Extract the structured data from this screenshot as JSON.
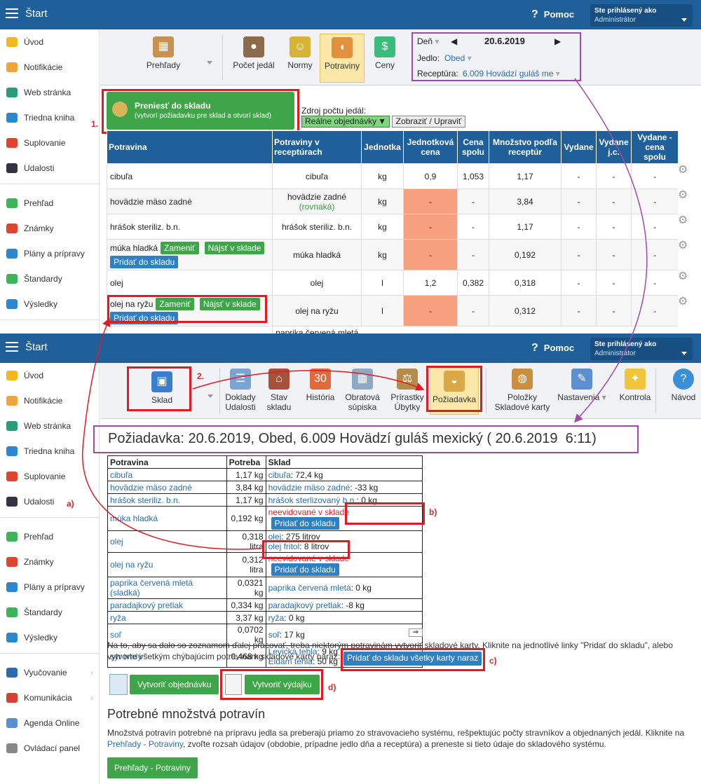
{
  "top": {
    "title": "Štart",
    "help": "Pomoc",
    "help_icon": "?",
    "user_line1": "Ste prihlásený ako",
    "user_line2": "Administrátor"
  },
  "sidebar1": [
    "Úvod",
    "Notifikácie",
    "Web stránka",
    "Triedna kniha",
    "Suplovanie",
    "Udalosti",
    "Prehľad",
    "Známky",
    "Plány a prípravy",
    "Štandardy",
    "Výsledky",
    "Vyučovanie"
  ],
  "sidebar2": [
    "Úvod",
    "Notifikácie",
    "Web stránka",
    "Triedna kniha",
    "Suplovanie",
    "Udalosti",
    "Prehľad",
    "Známky",
    "Plány a prípravy",
    "Štandardy",
    "Výsledky",
    "Vyučovanie",
    "Komunikácia",
    "Agenda Online",
    "Ovládací panel"
  ],
  "toolbar1": {
    "prehlady": "Prehľady",
    "pocet": "Počet jedál",
    "normy": "Normy",
    "potraviny": "Potraviny",
    "ceny": "Ceny"
  },
  "filter": {
    "den_label": "Deň",
    "date": "20.6.2019",
    "jedlo_label": "Jedlo:",
    "jedlo": "Obed",
    "receptura_label": "Receptúra:",
    "receptura": "6.009 Hovädzí guláš me"
  },
  "prenest": {
    "l1": "Preniesť do skladu",
    "l2": "(vytvorí požiadavku pre sklad a otvorí sklad)",
    "num": "1."
  },
  "zdroj": {
    "label": "Zdroj počtu jedál:",
    "select": "Reálne objednávky",
    "btn": "Zobraziť / Upraviť"
  },
  "table1": {
    "headers": [
      "Potravina",
      "Potraviny v receptúrach",
      "Jednotka",
      "Jednotková cena",
      "Cena spolu",
      "Množstvo podľa receptúr",
      "Vydane",
      "Vydane j.c.",
      "Vydane - cena spolu"
    ],
    "rows": [
      {
        "name": "cibuľa",
        "rec": "cibuľa",
        "unit": "kg",
        "jc": "0,9",
        "cs": "1,053",
        "mn": "1,17",
        "v": "-",
        "vjc": "-",
        "vcs": "-",
        "orange": false
      },
      {
        "name": "hovädzie mäso zadné",
        "rec": "hovädzie zadné",
        "rec2": "(rovnaká)",
        "unit": "kg",
        "jc": "-",
        "cs": "-",
        "mn": "3,84",
        "v": "-",
        "vjc": "-",
        "vcs": "-",
        "orange": true
      },
      {
        "name": "hrášok steriliz. b.n.",
        "rec": "hrášok steriliz. b.n.",
        "unit": "kg",
        "jc": "-",
        "cs": "-",
        "mn": "1,17",
        "v": "-",
        "vjc": "-",
        "vcs": "-",
        "orange": true
      },
      {
        "name": "múka hladká",
        "rec": "múka hladká",
        "unit": "kg",
        "jc": "-",
        "cs": "-",
        "mn": "0,192",
        "v": "-",
        "vjc": "-",
        "vcs": "-",
        "orange": true,
        "btns": true
      },
      {
        "name": "olej",
        "rec": "olej",
        "unit": "l",
        "jc": "1,2",
        "cs": "0,382",
        "mn": "0,318",
        "v": "-",
        "vjc": "-",
        "vcs": "-",
        "orange": false
      },
      {
        "name": "olej na ryžu",
        "rec": "olej na ryžu",
        "unit": "l",
        "jc": "-",
        "cs": "-",
        "mn": "0,312",
        "v": "-",
        "vjc": "-",
        "vcs": "-",
        "orange": true,
        "btns": true
      }
    ],
    "partial": "paprika červená mletá",
    "zamenit": "Zameniť",
    "najst": "Nájsť v sklade",
    "pridat": "Pridať do skladu"
  },
  "toolbar2": {
    "sklad": "Sklad",
    "num": "2.",
    "doklady": "Doklady\nUdalosti",
    "stav": "Stav\nskladu",
    "historia": "História",
    "obratova": "Obratová\nsúpiska",
    "prirastky": "Prírastky\nÚbytky",
    "poziadavka": "Požiadavka",
    "polozky": "Položky\nSkladové karty",
    "nastavenia": "Nastavenia",
    "kontrola": "Kontrola",
    "navod": "Návod"
  },
  "poz_title": "Požiadavka: 20.6.2019, Obed, 6.009 Hovädzí guláš mexický ( 20.6.2019  6:11)",
  "table2": {
    "headers": [
      "Potravina",
      "Potreba",
      "Sklad"
    ],
    "rows": [
      {
        "p": "cibuľa",
        "n": "1,17 kg",
        "s": [
          {
            "l": "cibuľa",
            "t": ": 72,4 kg"
          }
        ]
      },
      {
        "p": "hovädzie mäso zadné",
        "n": "3,84 kg",
        "s": [
          {
            "l": "hovädzie mäso zadné",
            "t": ": -33 kg"
          }
        ]
      },
      {
        "p": "hrášok steriliz. b.n.",
        "n": "1,17 kg",
        "s": [
          {
            "l": "hrášok sterlizovaný b.n.",
            "t": ": 0 kg"
          }
        ]
      },
      {
        "p": "múka hladká",
        "n": "0,192 kg",
        "red": "neevidované v sklade",
        "btn": true
      },
      {
        "p": "olej",
        "n": "0,318 litra",
        "s": [
          {
            "l": "olej",
            "t": ": 275 litrov"
          },
          {
            "l": "olej fritol",
            "t": ": 8 litrov"
          }
        ]
      },
      {
        "p": "olej na ryžu",
        "n": "0,312 litra",
        "red": "neevidované v sklade",
        "btn": true
      },
      {
        "p": "paprika červená mletá (sladká)",
        "n": "0,0321 kg",
        "s": [
          {
            "l": "paprika červená mletá",
            "t": ": 0 kg"
          }
        ]
      },
      {
        "p": "paradajkový pretlak",
        "n": "0,334 kg",
        "s": [
          {
            "l": "paradajkový pretlak",
            "t": ": -8 kg"
          }
        ]
      },
      {
        "p": "ryža",
        "n": "3,37 kg",
        "s": [
          {
            "l": "ryža",
            "t": ": 0 kg"
          }
        ]
      },
      {
        "p": "soľ",
        "n": "0,0702 kg",
        "s": [
          {
            "l": "soľ",
            "t": ": 17 kg"
          }
        ]
      },
      {
        "p": "syr tvrdý",
        "n": "0,468 kg",
        "s": [
          {
            "l": "Levická tehla",
            "t": ": 9 kg"
          },
          {
            "l": "Eidam tehla",
            "t": ": 50 kg"
          }
        ]
      }
    ]
  },
  "info": "Na to, aby sa dalo so zoznamom ďalej pracovať, treba niektorým potravinám vytvoriť skladové karty. Kliknite na jednotlivé linky \"Pridať do skladu\", alebo vytvorte všetkým chýbajúcim potravinám skladové karty naraz:",
  "all_btn": "Pridať do skladu všetky karty naraz",
  "obj_btn": "Vytvoriť objednávku",
  "vyd_btn": "Vytvoriť výdajku",
  "labels": {
    "a": "a)",
    "b": "b)",
    "c": "c)",
    "d": "d)"
  },
  "potrebne_title": "Potrebné množstvá potravín",
  "potrebne_text": "Množstvá potravín potrebné na prípravu jedla sa preberajú priamo zo stravovacieho systému, rešpektujúc počty stravníkov a objednaných jedál. Kliknite na",
  "potrebne_link": "Prehľady - Potraviny",
  "potrebne_text2": ", zvoľte rozsah údajov (obdobie, prípadne jedlo dňa a receptúra) a preneste si tieto údaje do skladového systému.",
  "prehlady_btn": "Prehľady - Potraviny",
  "colors": {
    "header": "#1f5f9a",
    "green": "#3ea648",
    "blue": "#2f80c2",
    "red": "#e11b22",
    "purple": "#a04aa9",
    "orange": "#f6a07f"
  }
}
